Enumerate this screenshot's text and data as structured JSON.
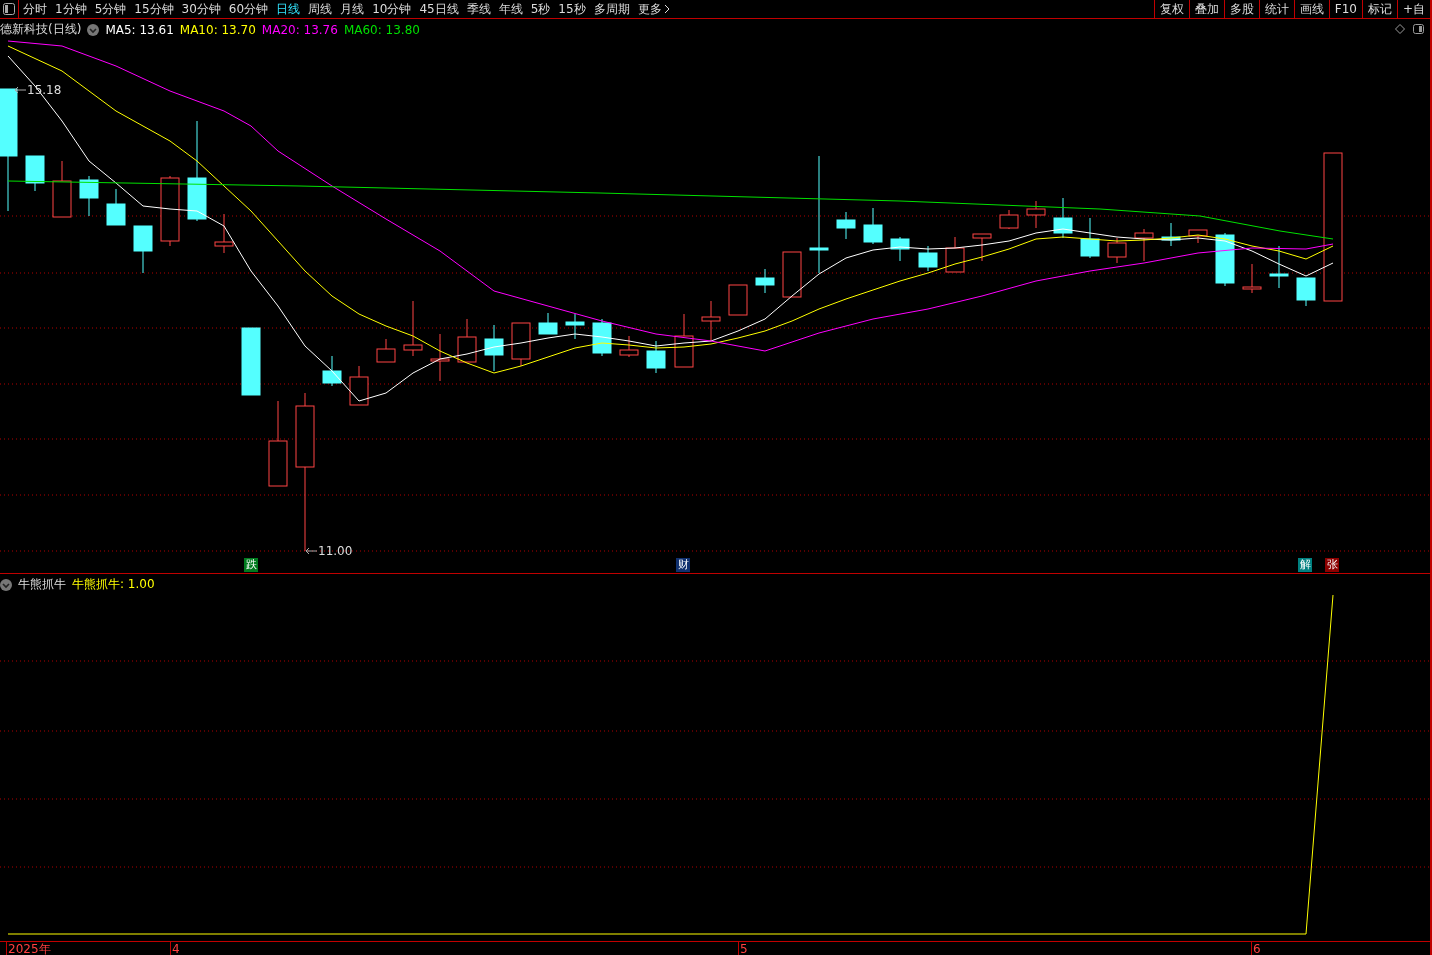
{
  "toolbar": {
    "periods": [
      {
        "label": "分时",
        "selected": false
      },
      {
        "label": "1分钟",
        "selected": false
      },
      {
        "label": "5分钟",
        "selected": false
      },
      {
        "label": "15分钟",
        "selected": false
      },
      {
        "label": "30分钟",
        "selected": false
      },
      {
        "label": "60分钟",
        "selected": false
      },
      {
        "label": "日线",
        "selected": true
      },
      {
        "label": "周线",
        "selected": false
      },
      {
        "label": "月线",
        "selected": false
      },
      {
        "label": "10分钟",
        "selected": false
      },
      {
        "label": "45日线",
        "selected": false
      },
      {
        "label": "季线",
        "selected": false
      },
      {
        "label": "年线",
        "selected": false
      },
      {
        "label": "5秒",
        "selected": false
      },
      {
        "label": "15秒",
        "selected": false
      },
      {
        "label": "多周期",
        "selected": false
      }
    ],
    "more": "更多",
    "tools": [
      "复权",
      "叠加",
      "多股",
      "统计",
      "画线",
      "F10",
      "标记",
      "+自"
    ]
  },
  "main_chart": {
    "title": "德新科技(日线)",
    "indicators": [
      {
        "label": "MA5: 13.61",
        "color": "#ffffff"
      },
      {
        "label": "MA10: 13.70",
        "color": "#ffff00"
      },
      {
        "label": "MA20: 13.76",
        "color": "#ff00ff"
      },
      {
        "label": "MA60: 13.80",
        "color": "#00e000"
      }
    ],
    "high_label": "15.18",
    "low_label": "11.00",
    "markers": [
      {
        "label": "跌",
        "color": "#007a1e"
      },
      {
        "label": "财",
        "color": "#10306e"
      },
      {
        "label": "解",
        "color": "#008080"
      },
      {
        "label": "张",
        "color": "#8b0000"
      }
    ]
  },
  "sub_chart": {
    "title": "牛熊抓牛",
    "value": "牛熊抓牛: 1.00"
  },
  "time_axis": [
    "2025年",
    "4",
    "5",
    "6"
  ]
}
